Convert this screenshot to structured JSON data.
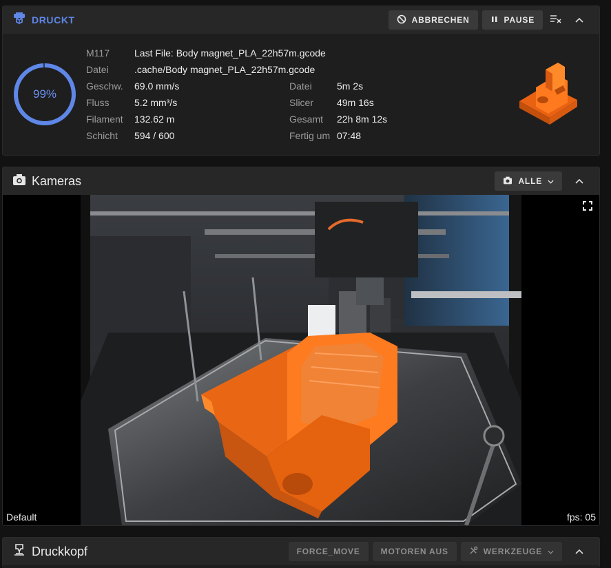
{
  "print": {
    "title": "DRUCKT",
    "buttons": {
      "cancel": "ABBRECHEN",
      "pause": "PAUSE"
    },
    "progress": {
      "value": 0.99,
      "label": "99%"
    },
    "info_left": [
      {
        "label": "M117",
        "value": "Last File: Body magnet_PLA_22h57m.gcode"
      },
      {
        "label": "Datei",
        "value": ".cache/Body magnet_PLA_22h57m.gcode"
      },
      {
        "label": "Geschw.",
        "value": "69.0 mm/s"
      },
      {
        "label": "Fluss",
        "value": "5.2 mm³/s"
      },
      {
        "label": "Filament",
        "value": "132.62 m"
      },
      {
        "label": "Schicht",
        "value": "594 / 600"
      }
    ],
    "info_right": [
      {
        "label": "Datei",
        "value": "5m 2s"
      },
      {
        "label": "Slicer",
        "value": "49m 16s"
      },
      {
        "label": "Gesamt",
        "value": "22h 8m 12s"
      },
      {
        "label": "Fertig um",
        "value": "07:48"
      }
    ]
  },
  "cameras": {
    "title": "Kameras",
    "select_label": "ALLE",
    "camera_name": "Default",
    "fps": "fps: 05"
  },
  "toolhead": {
    "title": "Druckkopf",
    "buttons": {
      "force_move": "FORCE_MOVE",
      "motors_off": "MOTOREN AUS",
      "tools": "WERKZEUGE"
    }
  },
  "colors": {
    "accent": "#5f87e8",
    "print_orange": "#ff6a13"
  }
}
